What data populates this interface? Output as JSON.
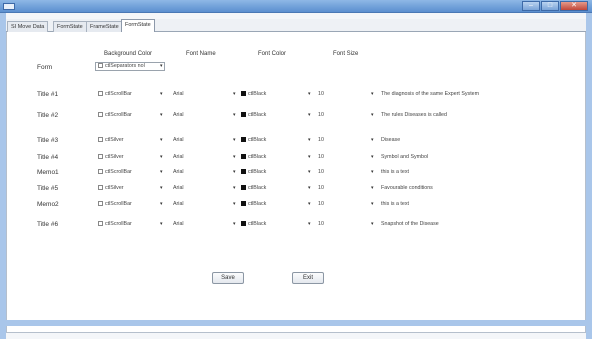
{
  "window": {
    "buttons": [
      "–",
      "□",
      "✕"
    ]
  },
  "tabs": [
    {
      "label": "SI Move Data"
    },
    {
      "label": "FormState"
    },
    {
      "label": "FrameState"
    },
    {
      "label": "FormState"
    }
  ],
  "headers": {
    "background_color": "Background Color",
    "font_name": "Font Name",
    "font_color": "Font Color",
    "font_size": "Font Size"
  },
  "form_row": {
    "label": "Form",
    "background": "ctlSeparators nol"
  },
  "rows": [
    {
      "label": "Title #1",
      "background": "ctlScrollBar",
      "font": "Arial",
      "color": "ctlBlack",
      "size": "10",
      "text": "The diagnosis of the same Expert System"
    },
    {
      "label": "Title #2",
      "background": "ctlScrollBar",
      "font": "Arial",
      "color": "ctlBlack",
      "size": "10",
      "text": "The rules Diseases is called"
    },
    {
      "label": "Title #3",
      "background": "ctlSilver",
      "font": "Arial",
      "color": "ctlBlack",
      "size": "10",
      "text": "Disease"
    },
    {
      "label": "Title #4",
      "background": "ctlSilver",
      "font": "Arial",
      "color": "ctlBlack",
      "size": "10",
      "text": "Symbol and Symbol"
    },
    {
      "label": "Memo1",
      "background": "ctlScrollBar",
      "font": "Arial",
      "color": "ctlBlack",
      "size": "10",
      "text": "this is a text"
    },
    {
      "label": "Title #5",
      "background": "ctlSilver",
      "font": "Arial",
      "color": "ctlBlack",
      "size": "10",
      "text": "Favourable conditions"
    },
    {
      "label": "Memo2",
      "background": "ctlScrollBar",
      "font": "Arial",
      "color": "ctlBlack",
      "size": "10",
      "text": "this is a text"
    },
    {
      "label": "Title #6",
      "background": "ctlScrollBar",
      "font": "Arial",
      "color": "ctlBlack",
      "size": "10",
      "text": "Snapshot of the Disease"
    }
  ],
  "buttons": {
    "save": "Save",
    "exit": "Exit"
  }
}
